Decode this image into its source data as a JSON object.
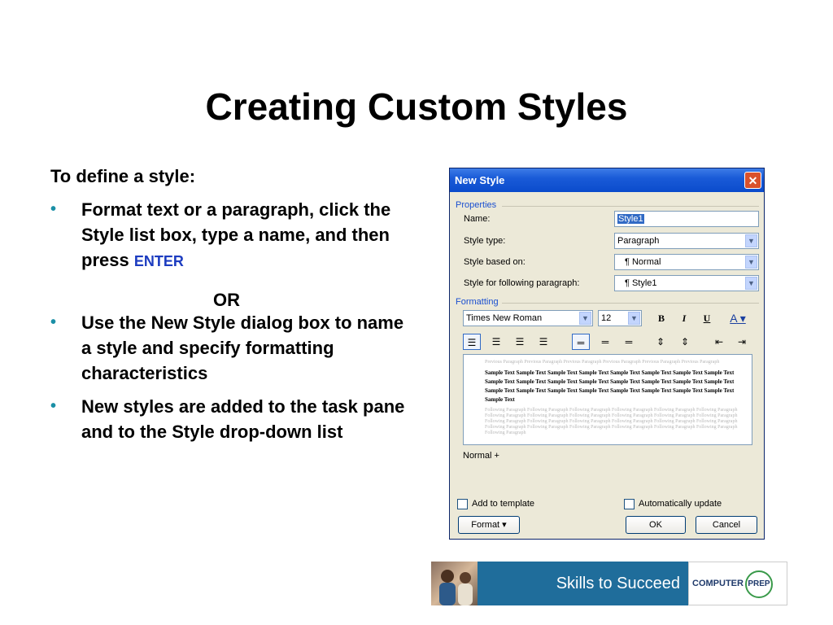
{
  "slide": {
    "title": "Creating Custom Styles",
    "intro": "To define a style:",
    "bullet1_text": "Format text or a paragraph, click the Style list box, type a name, and then press ",
    "bullet1_key": "ENTER",
    "or_text": "OR",
    "bullet2_text": "Use the New Style dialog box to name a style and specify formatting characteristics",
    "bullet3_text": "New styles are added to the task pane and to the Style drop-down list",
    "bullet_glyph": "•",
    "bullet_color": "#1a8fa6",
    "key_color": "#1c3cc0"
  },
  "dialog": {
    "title": "New Style",
    "close_glyph": "✕",
    "properties_label": "Properties",
    "name_label": "Name:",
    "name_value": "Style1",
    "style_type_label": "Style type:",
    "style_type_value": "Paragraph",
    "based_on_label": "Style based on:",
    "based_on_value": "¶ Normal",
    "following_label": "Style for following paragraph:",
    "following_value": "¶ Style1",
    "formatting_label": "Formatting",
    "font_value": "Times New Roman",
    "size_value": "12",
    "bold_glyph": "B",
    "italic_glyph": "I",
    "underline_glyph": "U",
    "font_color_glyph": "A",
    "preview_prev": "Previous Paragraph Previous Paragraph Previous Paragraph Previous Paragraph Previous Paragraph Previous Paragraph",
    "preview_sample": "Sample Text Sample Text Sample Text Sample Text Sample Text Sample Text Sample Text Sample Text Sample Text Sample Text Sample Text Sample Text Sample Text Sample Text Sample Text Sample Text Sample Text Sample Text Sample Text Sample Text Sample Text Sample Text Sample Text Sample Text Sample Text",
    "preview_next": "Following Paragraph Following Paragraph Following Paragraph Following Paragraph Following Paragraph Following Paragraph Following Paragraph Following Paragraph Following Paragraph Following Paragraph Following Paragraph Following Paragraph Following Paragraph Following Paragraph Following Paragraph Following Paragraph Following Paragraph Following Paragraph Following Paragraph Following Paragraph Following Paragraph Following Paragraph Following Paragraph Following Paragraph Following Paragraph",
    "description": "Normal +",
    "add_to_template_label": "Add to template",
    "auto_update_label": "Automatically update",
    "format_button": "Format ▾",
    "ok_button": "OK",
    "cancel_button": "Cancel",
    "titlebar_color": "#1a5bd8",
    "dialog_bg": "#ece9d8"
  },
  "banner": {
    "tagline": "Skills to Succeed",
    "logo_text": "COMPUTER",
    "logo_circle": "PREP"
  }
}
